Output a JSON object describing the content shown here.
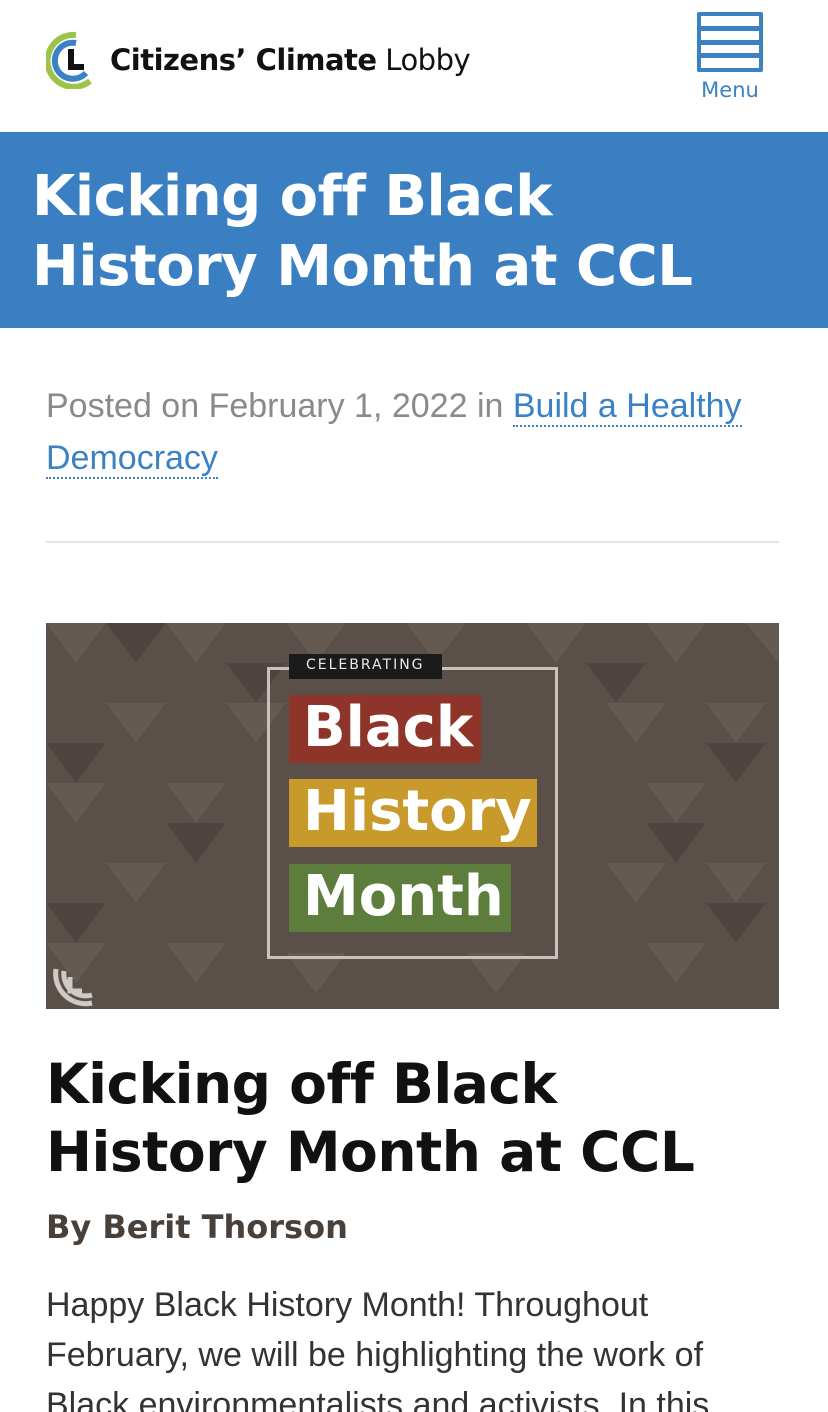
{
  "header": {
    "logo_bold": "Citizens’ Climate",
    "logo_light": "Lobby",
    "menu_label": "Menu"
  },
  "page": {
    "title": "Kicking off Black History Month at CCL"
  },
  "meta": {
    "posted_prefix": "Posted on February 1, 2022 in ",
    "category_link": "Build a Healthy Democracy"
  },
  "feature_image": {
    "tag": "CELEBRATING",
    "line1": "Black",
    "line2": "History",
    "line3": "Month"
  },
  "article": {
    "title": "Kicking off Black History Month at CCL",
    "byline": "By Berit Thorson",
    "intro": "Happy Black History Month! Throughout February, we will be highlighting the work of Black environmentalists and activists. In this"
  },
  "colors": {
    "brand_blue": "#3a7fc1",
    "link_blue": "#3a82c4",
    "bar_red": "#8f3428",
    "bar_gold": "#c89a2c",
    "bar_green": "#5d7d3c"
  }
}
